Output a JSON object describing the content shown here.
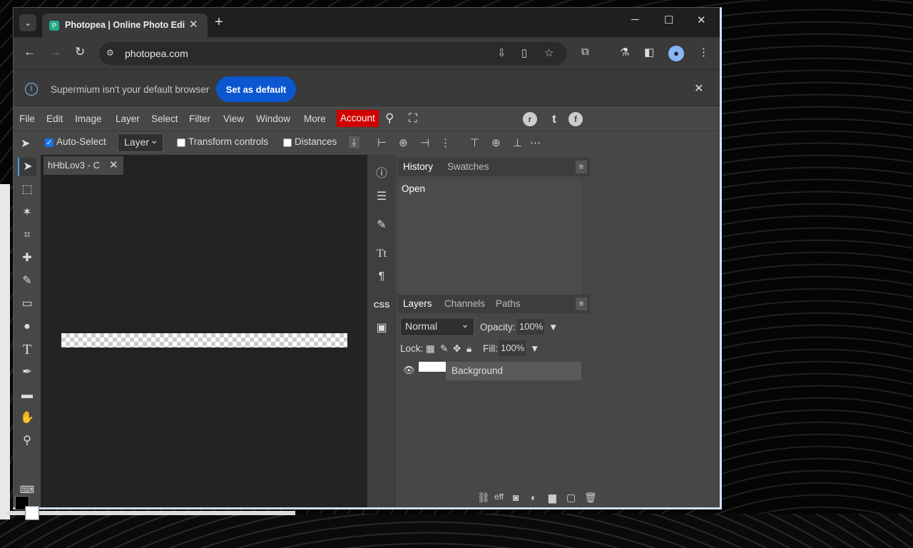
{
  "browser": {
    "tab_title": "Photopea | Online Photo Editor",
    "url": "photopea.com",
    "infobar_message": "Supermium isn't your default browser",
    "set_default_label": "Set as default"
  },
  "menu": {
    "items": [
      "File",
      "Edit",
      "Image",
      "Layer",
      "Select",
      "Filter",
      "View",
      "Window",
      "More"
    ],
    "account": "Account"
  },
  "options": {
    "auto_select": "Auto-Select",
    "auto_select_checked": true,
    "target": "Layer",
    "transform_controls": "Transform controls",
    "distances": "Distances"
  },
  "document": {
    "tab_title": "hHbLov3 - C"
  },
  "history_panel": {
    "tabs": [
      "History",
      "Swatches"
    ],
    "entries": [
      "Open"
    ]
  },
  "layers_panel": {
    "tabs": [
      "Layers",
      "Channels",
      "Paths"
    ],
    "blend_mode": "Normal",
    "opacity_label": "Opacity:",
    "opacity": "100%",
    "lock_label": "Lock:",
    "fill_label": "Fill:",
    "fill": "100%",
    "layers": [
      {
        "name": "Background"
      }
    ]
  },
  "colors": {
    "foreground": "#000000",
    "background": "#ffffff",
    "accent": "#d10000",
    "primary_button": "#0b57d0"
  }
}
